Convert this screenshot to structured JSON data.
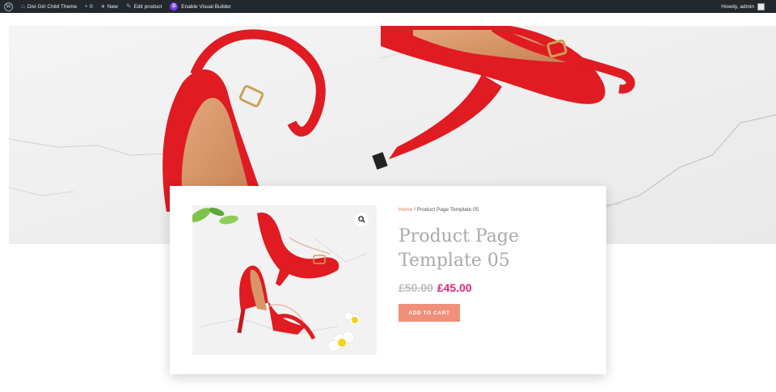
{
  "adminbar": {
    "site_name": "Divi Girl Child Theme",
    "comments_count": "0",
    "new_label": "New",
    "edit_label": "Edit product",
    "divi_badge": "D",
    "builder_label": "Enable Visual Builder",
    "howdy": "Howdy, admin",
    "icons": {
      "wp": "wordpress-logo",
      "site": "home-icon",
      "comments": "comment-bubble",
      "new": "plus",
      "edit": "pencil",
      "divi": "divi-logo"
    }
  },
  "product": {
    "breadcrumb_home": "Home",
    "breadcrumb_sep": " / ",
    "breadcrumb_current": "Product Page Template 05",
    "title": "Product Page Template 05",
    "old_price": "£50.00",
    "price": "£45.00",
    "cta": "ADD TO CART"
  },
  "colors": {
    "adminbar_bg": "#23282d",
    "accent": "#e0267a",
    "button": "#f0907a",
    "breadcrumb_link": "#e8735a",
    "title": "#a9a9a9",
    "shoe_red": "#e01b22"
  }
}
